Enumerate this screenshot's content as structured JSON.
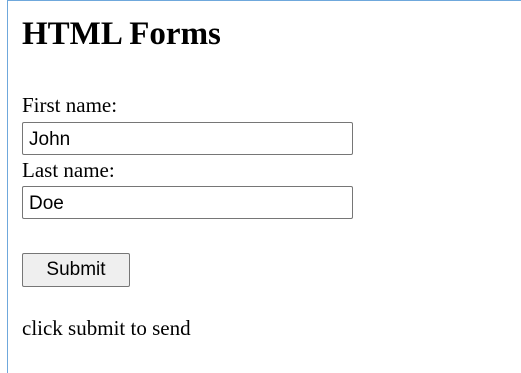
{
  "page": {
    "heading": "HTML Forms",
    "note": "click submit to send"
  },
  "form": {
    "first_name_label": "First name:",
    "first_name_value": "John",
    "last_name_label": "Last name:",
    "last_name_value": "Doe",
    "submit_label": "Submit"
  },
  "colors": {
    "frame_border": "#6fa8dc",
    "button_background": "#efefef",
    "input_border": "#767676"
  }
}
